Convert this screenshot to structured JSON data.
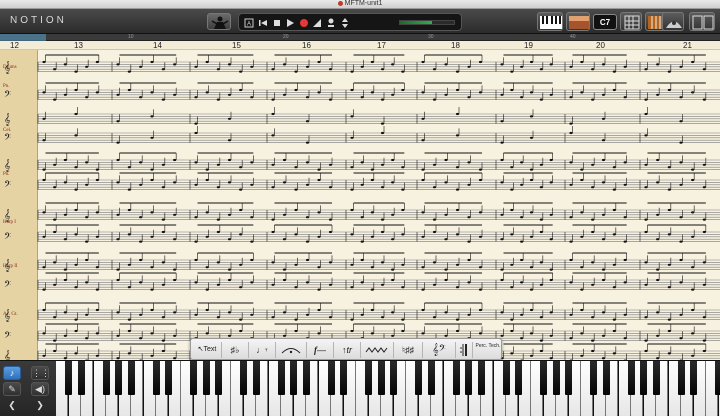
{
  "window": {
    "title": "MFTM-unit1"
  },
  "toolbar": {
    "brand": "NOTION",
    "key_signature": "C7",
    "ruler_markers": [
      "10",
      "20",
      "30",
      "40"
    ]
  },
  "score": {
    "current_measure": "12",
    "measures": [
      "13",
      "14",
      "15",
      "16",
      "17",
      "18",
      "19",
      "20",
      "21"
    ],
    "instruments": [
      {
        "label": "Drums"
      },
      {
        "label": "Pn."
      },
      {
        "label": "Cel."
      },
      {
        "label": "Pn."
      },
      {
        "label": "Harp I"
      },
      {
        "label": "Harp II"
      },
      {
        "label": "Ac. Gt."
      }
    ]
  },
  "palette": {
    "text_tool": "Text",
    "sharp_flat": "♯♭",
    "rests": "♩𝄾",
    "dynamics": "𝄐",
    "articulation": "tr",
    "accidentals": "♮♯♯",
    "clefs": "𝄞𝄢",
    "percussion_tech": "Perc. Tech."
  },
  "colors": {
    "accent": "#3b82d6",
    "record": "#e53935",
    "paper": "#f7f1df",
    "instrument_panel": "#e6d3a4"
  }
}
